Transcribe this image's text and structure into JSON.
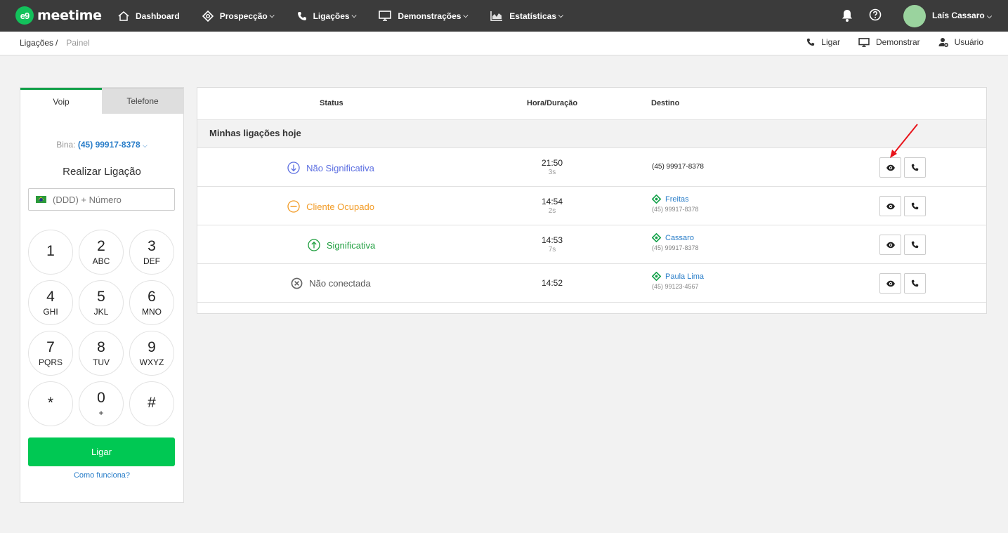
{
  "app": {
    "logo_mark": "e9",
    "logo_text": "meetime"
  },
  "nav": {
    "items": [
      {
        "label": "Dashboard",
        "icon": "home-icon",
        "dropdown": false
      },
      {
        "label": "Prospecção",
        "icon": "target-icon",
        "dropdown": true
      },
      {
        "label": "Ligações",
        "icon": "phone-icon",
        "dropdown": true
      },
      {
        "label": "Demonstrações",
        "icon": "monitor-icon",
        "dropdown": true
      },
      {
        "label": "Estatísticas",
        "icon": "chart-icon",
        "dropdown": true
      }
    ],
    "user_name": "Laís Cassaro"
  },
  "breadcrumb": {
    "parent": "Ligações",
    "separator": "/",
    "current": "Painel"
  },
  "sub_actions": [
    {
      "label": "Ligar",
      "icon": "phone-icon"
    },
    {
      "label": "Demonstrar",
      "icon": "monitor-icon"
    },
    {
      "label": "Usuário",
      "icon": "user-add-icon"
    }
  ],
  "dialer": {
    "tabs": [
      "Voip",
      "Telefone"
    ],
    "active_tab": "Voip",
    "bina_label": "Bina:",
    "bina_number": "(45) 99917-8378",
    "title": "Realizar Ligação",
    "input_placeholder": "(DDD) + Número",
    "keys": [
      {
        "digit": "1",
        "letters": ""
      },
      {
        "digit": "2",
        "letters": "ABC"
      },
      {
        "digit": "3",
        "letters": "DEF"
      },
      {
        "digit": "4",
        "letters": "GHI"
      },
      {
        "digit": "5",
        "letters": "JKL"
      },
      {
        "digit": "6",
        "letters": "MNO"
      },
      {
        "digit": "7",
        "letters": "PQRS"
      },
      {
        "digit": "8",
        "letters": "TUV"
      },
      {
        "digit": "9",
        "letters": "WXYZ"
      },
      {
        "digit": "*",
        "letters": ""
      },
      {
        "digit": "0",
        "letters": "+"
      },
      {
        "digit": "#",
        "letters": ""
      }
    ],
    "call_label": "Ligar",
    "how_label": "Como funciona?"
  },
  "calls": {
    "headers": {
      "status": "Status",
      "time": "Hora/Duração",
      "dest": "Destino"
    },
    "section_title": "Minhas ligações hoje",
    "rows": [
      {
        "status": "Não Significativa",
        "status_color": "#5b6ee1",
        "status_icon": "arrow-down-circle-icon",
        "time": "21:50",
        "duration": "3s",
        "contact": "",
        "phone": "(45) 99917-8378"
      },
      {
        "status": "Cliente Ocupado",
        "status_color": "#f29b25",
        "status_icon": "minus-circle-icon",
        "time": "14:54",
        "duration": "2s",
        "contact": "Freitas",
        "phone": "(45) 99917-8378"
      },
      {
        "status": "Significativa",
        "status_color": "#1e9e3e",
        "status_icon": "arrow-up-circle-icon",
        "time": "14:53",
        "duration": "7s",
        "contact": "Cassaro",
        "phone": "(45) 99917-8378"
      },
      {
        "status": "Não conectada",
        "status_color": "#666666",
        "status_icon": "x-circle-icon",
        "time": "14:52",
        "duration": "",
        "contact": "Paula Lima",
        "phone": "(45) 99123-4567"
      }
    ]
  },
  "colors": {
    "topbar": "#3b3b3b",
    "brand_green": "#13c15b",
    "call_button": "#00c853",
    "link_blue": "#2a7ec9",
    "annotation_red": "#e8141b"
  }
}
